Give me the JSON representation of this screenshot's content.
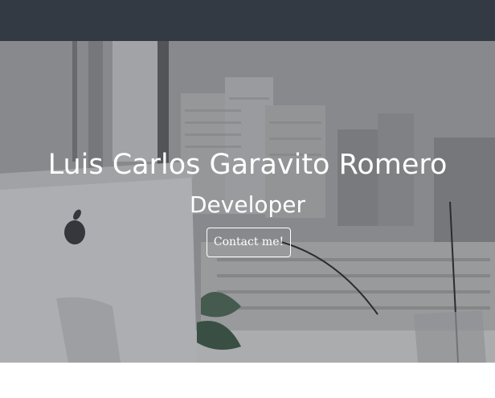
{
  "navbar": {
    "background_color": "#343a44"
  },
  "hero": {
    "name": "Luis Carlos Garavito Romero",
    "role": "Developer",
    "contact_button_label": "Contact me!",
    "text_color": "#ffffff",
    "background_image": "office-desk-with-computer-and-plants"
  }
}
